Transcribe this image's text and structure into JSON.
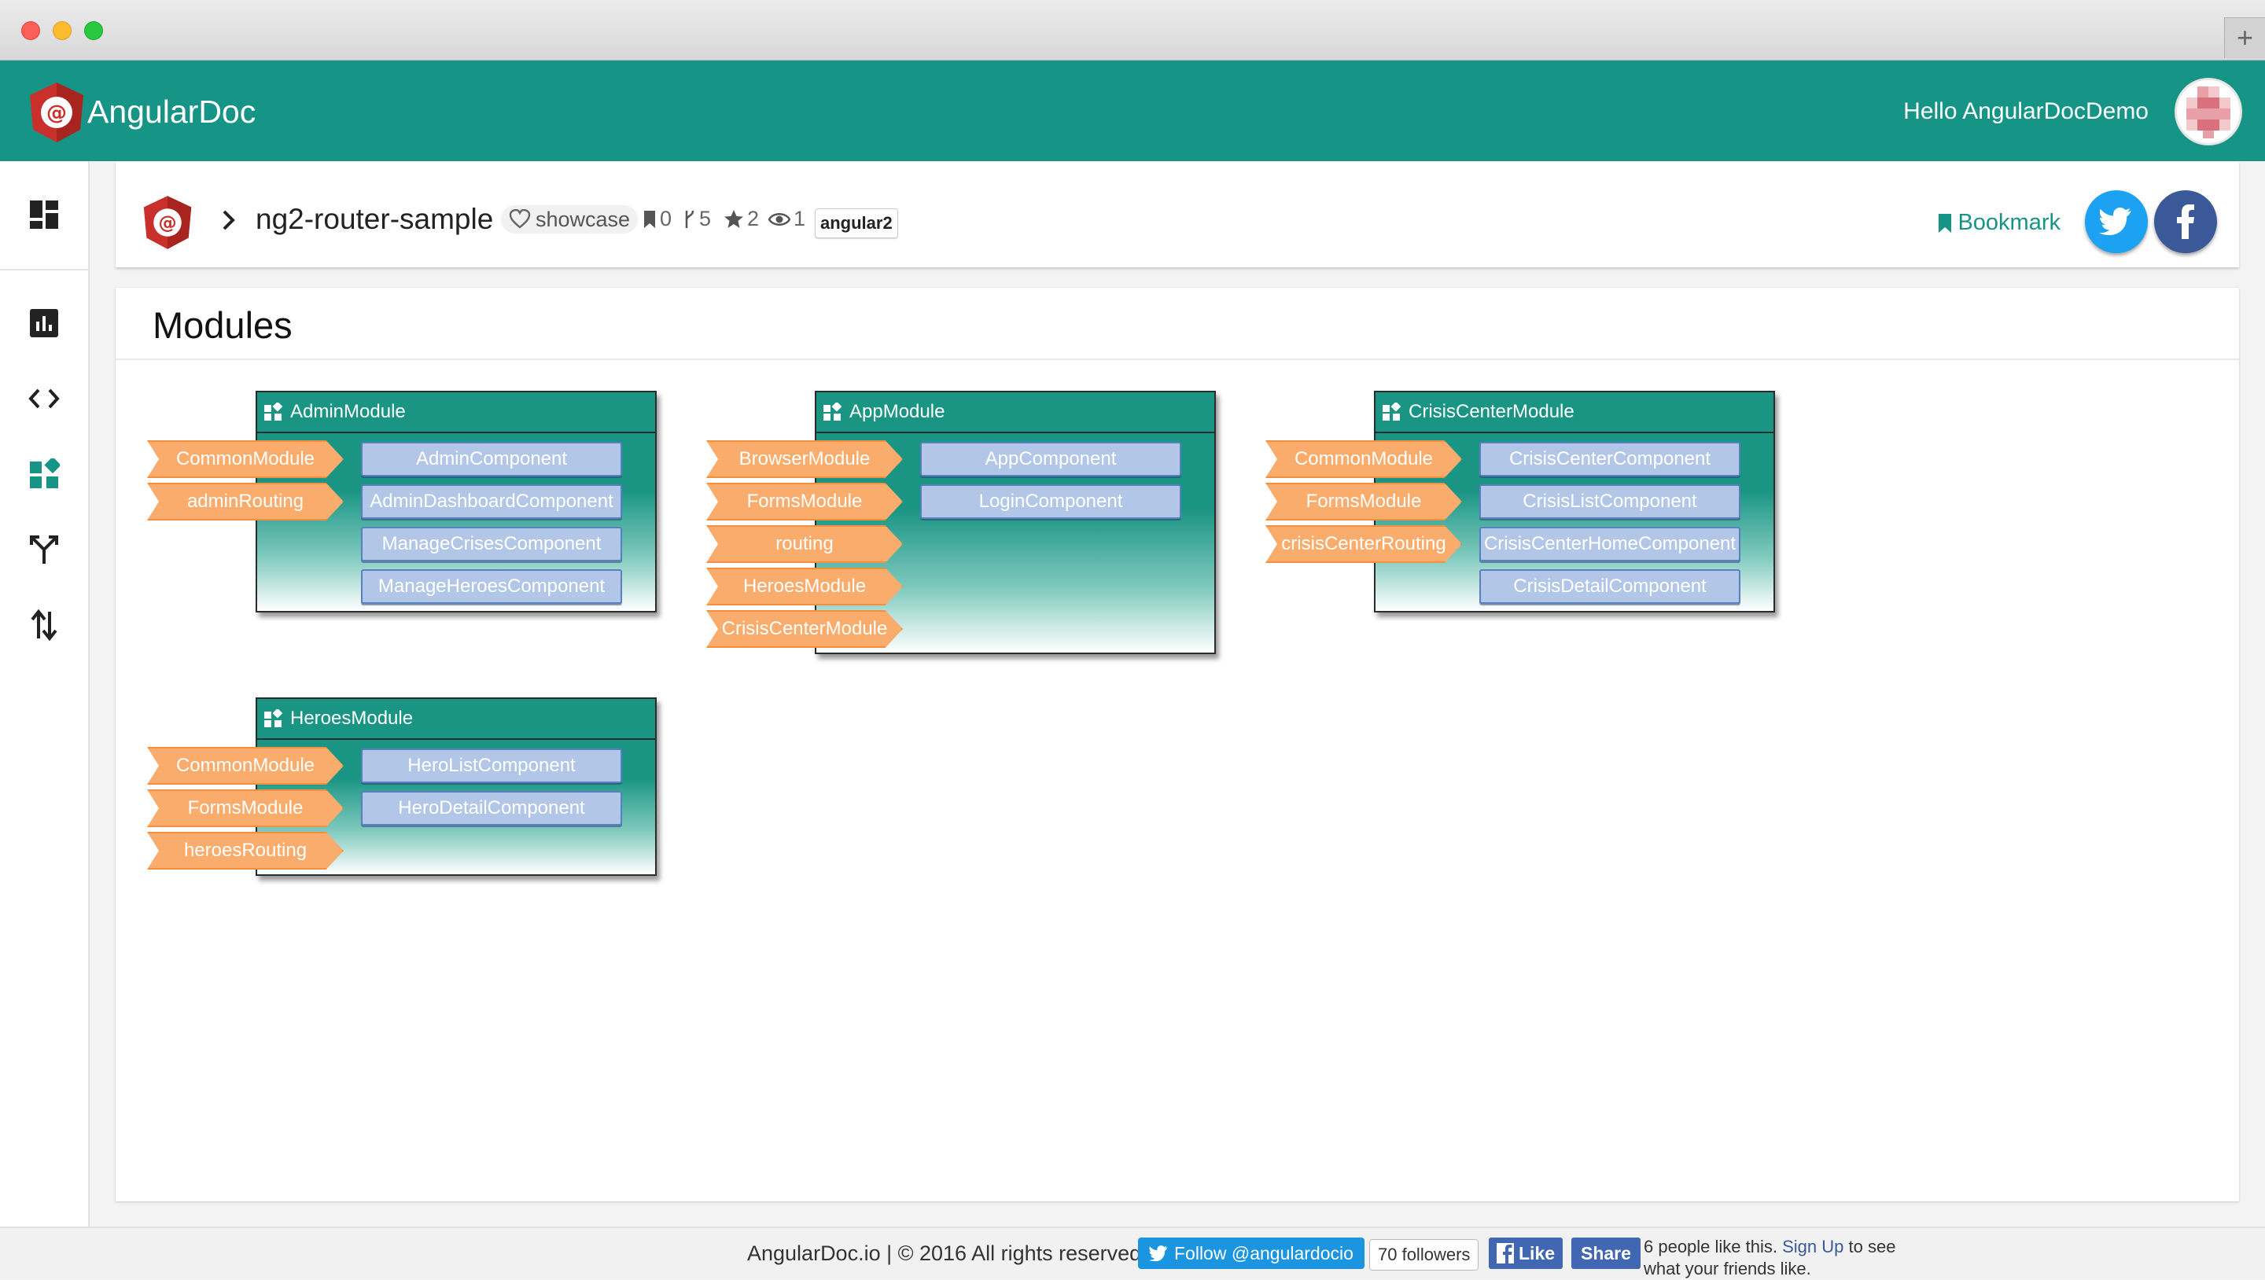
{
  "header": {
    "brand": "AngularDoc",
    "greeting": "Hello AngularDocDemo"
  },
  "project": {
    "name": "ng2-router-sample",
    "showcase_label": "showcase",
    "bookmarks": "0",
    "forks": "5",
    "stars": "2",
    "watchers": "1",
    "tag": "angular2",
    "bookmark_label": "Bookmark"
  },
  "panel": {
    "title": "Modules"
  },
  "modules": [
    {
      "name": "AdminModule",
      "imports": [
        "CommonModule",
        "adminRouting"
      ],
      "components": [
        "AdminComponent",
        "AdminDashboardComponent",
        "ManageCrisesComponent",
        "ManageHeroesComponent"
      ]
    },
    {
      "name": "AppModule",
      "imports": [
        "BrowserModule",
        "FormsModule",
        "routing",
        "HeroesModule",
        "CrisisCenterModule"
      ],
      "components": [
        "AppComponent",
        "LoginComponent"
      ]
    },
    {
      "name": "CrisisCenterModule",
      "imports": [
        "CommonModule",
        "FormsModule",
        "crisisCenterRouting"
      ],
      "components": [
        "CrisisCenterComponent",
        "CrisisListComponent",
        "CrisisCenterHomeComponent",
        "CrisisDetailComponent"
      ]
    },
    {
      "name": "HeroesModule",
      "imports": [
        "CommonModule",
        "FormsModule",
        "heroesRouting"
      ],
      "components": [
        "HeroListComponent",
        "HeroDetailComponent"
      ]
    }
  ],
  "footer": {
    "copyright": "AngularDoc.io | © 2016 All rights reserved",
    "twitter_follow": "Follow @angulardocio",
    "followers": "70 followers",
    "fb_like": "Like",
    "fb_share": "Share",
    "likes_text": "6 people like this.",
    "signup": "Sign Up",
    "likes_suffix": "to see what your friends like."
  },
  "colors": {
    "brand": "#169486",
    "import_arrow": "#f9ac6c",
    "component_box": "#b2c7e8",
    "twitter": "#1da1f2",
    "facebook": "#3b5998"
  }
}
